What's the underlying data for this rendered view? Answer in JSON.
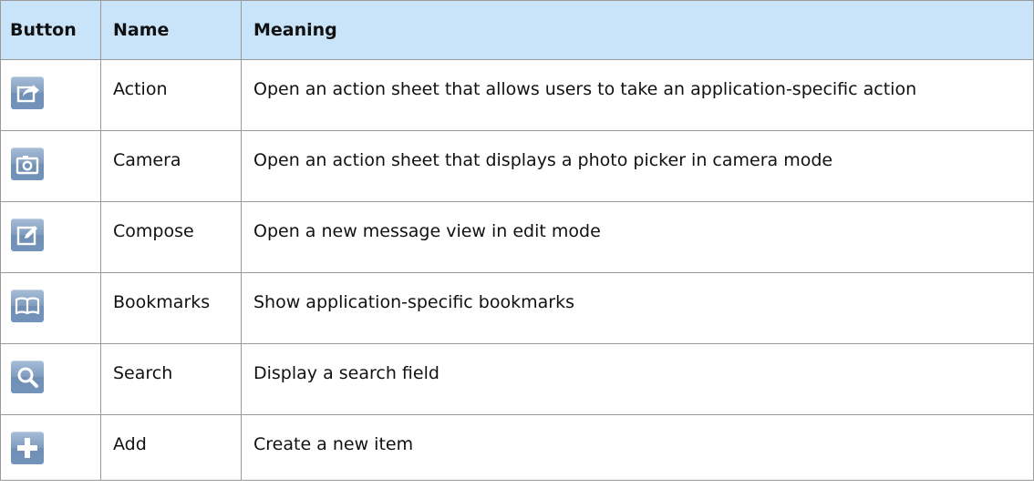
{
  "header": {
    "button": "Button",
    "name": "Name",
    "meaning": "Meaning"
  },
  "rows": [
    {
      "icon": "action-icon",
      "name": "Action",
      "meaning": "Open an action sheet that allows users to take an application-specific action"
    },
    {
      "icon": "camera-icon",
      "name": "Camera",
      "meaning": "Open an action sheet that displays a photo picker in camera mode"
    },
    {
      "icon": "compose-icon",
      "name": "Compose",
      "meaning": "Open a new message view in edit mode"
    },
    {
      "icon": "bookmarks-icon",
      "name": "Bookmarks",
      "meaning": "Show application-specific bookmarks"
    },
    {
      "icon": "search-icon",
      "name": "Search",
      "meaning": "Display a search field"
    },
    {
      "icon": "add-icon",
      "name": "Add",
      "meaning": "Create a new item"
    }
  ],
  "colors": {
    "header_background": "#c9e4f9",
    "border": "#9a9a9a",
    "icon_tile": "#7f9cbe"
  }
}
